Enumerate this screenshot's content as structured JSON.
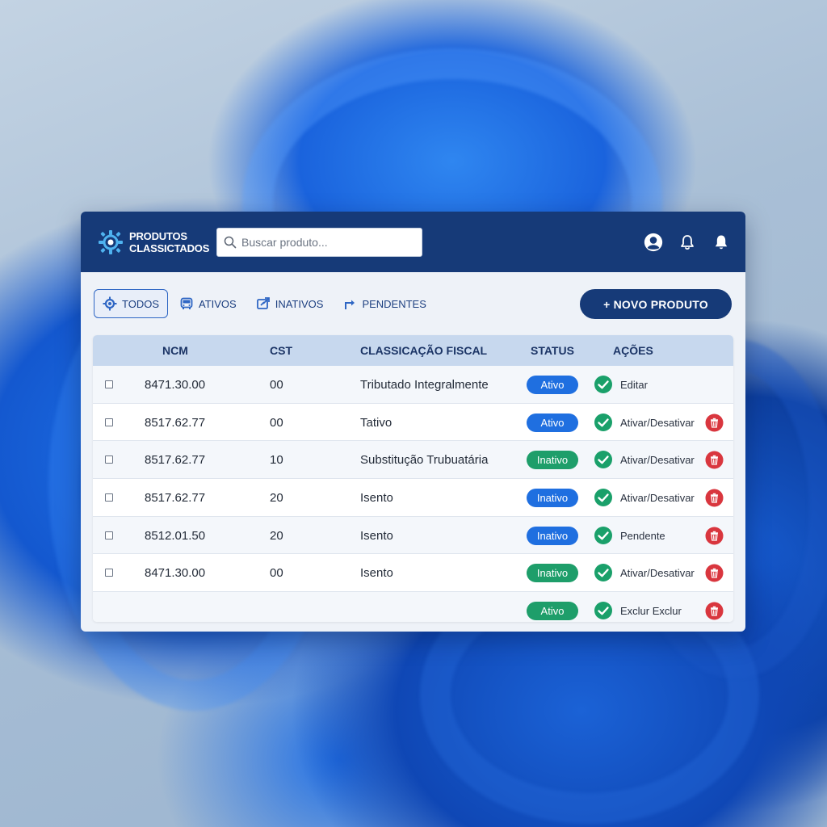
{
  "app": {
    "title_line1": "PRODUTOS",
    "title_line2": "CLASSICTADOS"
  },
  "search": {
    "placeholder": "Buscar produto..."
  },
  "filters": [
    {
      "label": "TODOS",
      "icon": "gear-icon",
      "active": true
    },
    {
      "label": "ATIVOS",
      "icon": "bus-icon",
      "active": false
    },
    {
      "label": "INATIVOS",
      "icon": "export-icon",
      "active": false
    },
    {
      "label": "PENDENTES",
      "icon": "share-arrow-icon",
      "active": false
    }
  ],
  "new_button": {
    "label": "+ NOVO PRODUTO"
  },
  "table": {
    "columns": [
      "NCM",
      "CST",
      "CLASSICAÇÃO FISCAL",
      "STATUS",
      "AÇÕES"
    ],
    "rows": [
      {
        "ncm": "8471.30.00",
        "cst": "00",
        "classificacao": "Tributado Integralmente",
        "status": "Ativo",
        "status_color": "#1f6fe0",
        "action": "Editar",
        "delete": false
      },
      {
        "ncm": "8517.62.77",
        "cst": "00",
        "classificacao": "Tativo",
        "status": "Ativo",
        "status_color": "#1f6fe0",
        "action": "Ativar/Desativar",
        "delete": true
      },
      {
        "ncm": "8517.62.77",
        "cst": "10",
        "classificacao": "Substitução Trubuatária",
        "status": "Inativo",
        "status_color": "#1e9e6a",
        "action": "Ativar/Desativar",
        "delete": true
      },
      {
        "ncm": "8517.62.77",
        "cst": "20",
        "classificacao": "Isento",
        "status": "Inativo",
        "status_color": "#1f6fe0",
        "action": "Ativar/Desativar",
        "delete": true
      },
      {
        "ncm": "8512.01.50",
        "cst": "20",
        "classificacao": "Isento",
        "status": "Inativo",
        "status_color": "#1f6fe0",
        "action": "Pendente",
        "delete": true
      },
      {
        "ncm": "8471.30.00",
        "cst": "00",
        "classificacao": "Isento",
        "status": "Inativo",
        "status_color": "#1e9e6a",
        "action": "Ativar/Desativar",
        "delete": true
      },
      {
        "ncm": "",
        "cst": "",
        "classificacao": "",
        "status": "Ativo",
        "status_color": "#1e9e6a",
        "action": "Exclur   Exclur",
        "delete": true,
        "no_checkbox": true
      }
    ]
  },
  "colors": {
    "header_bg": "#163a78",
    "accent_blue": "#1f6fe0",
    "accent_green": "#1e9e6a",
    "check_green": "#1aa06a",
    "delete_red": "#d9363e"
  }
}
